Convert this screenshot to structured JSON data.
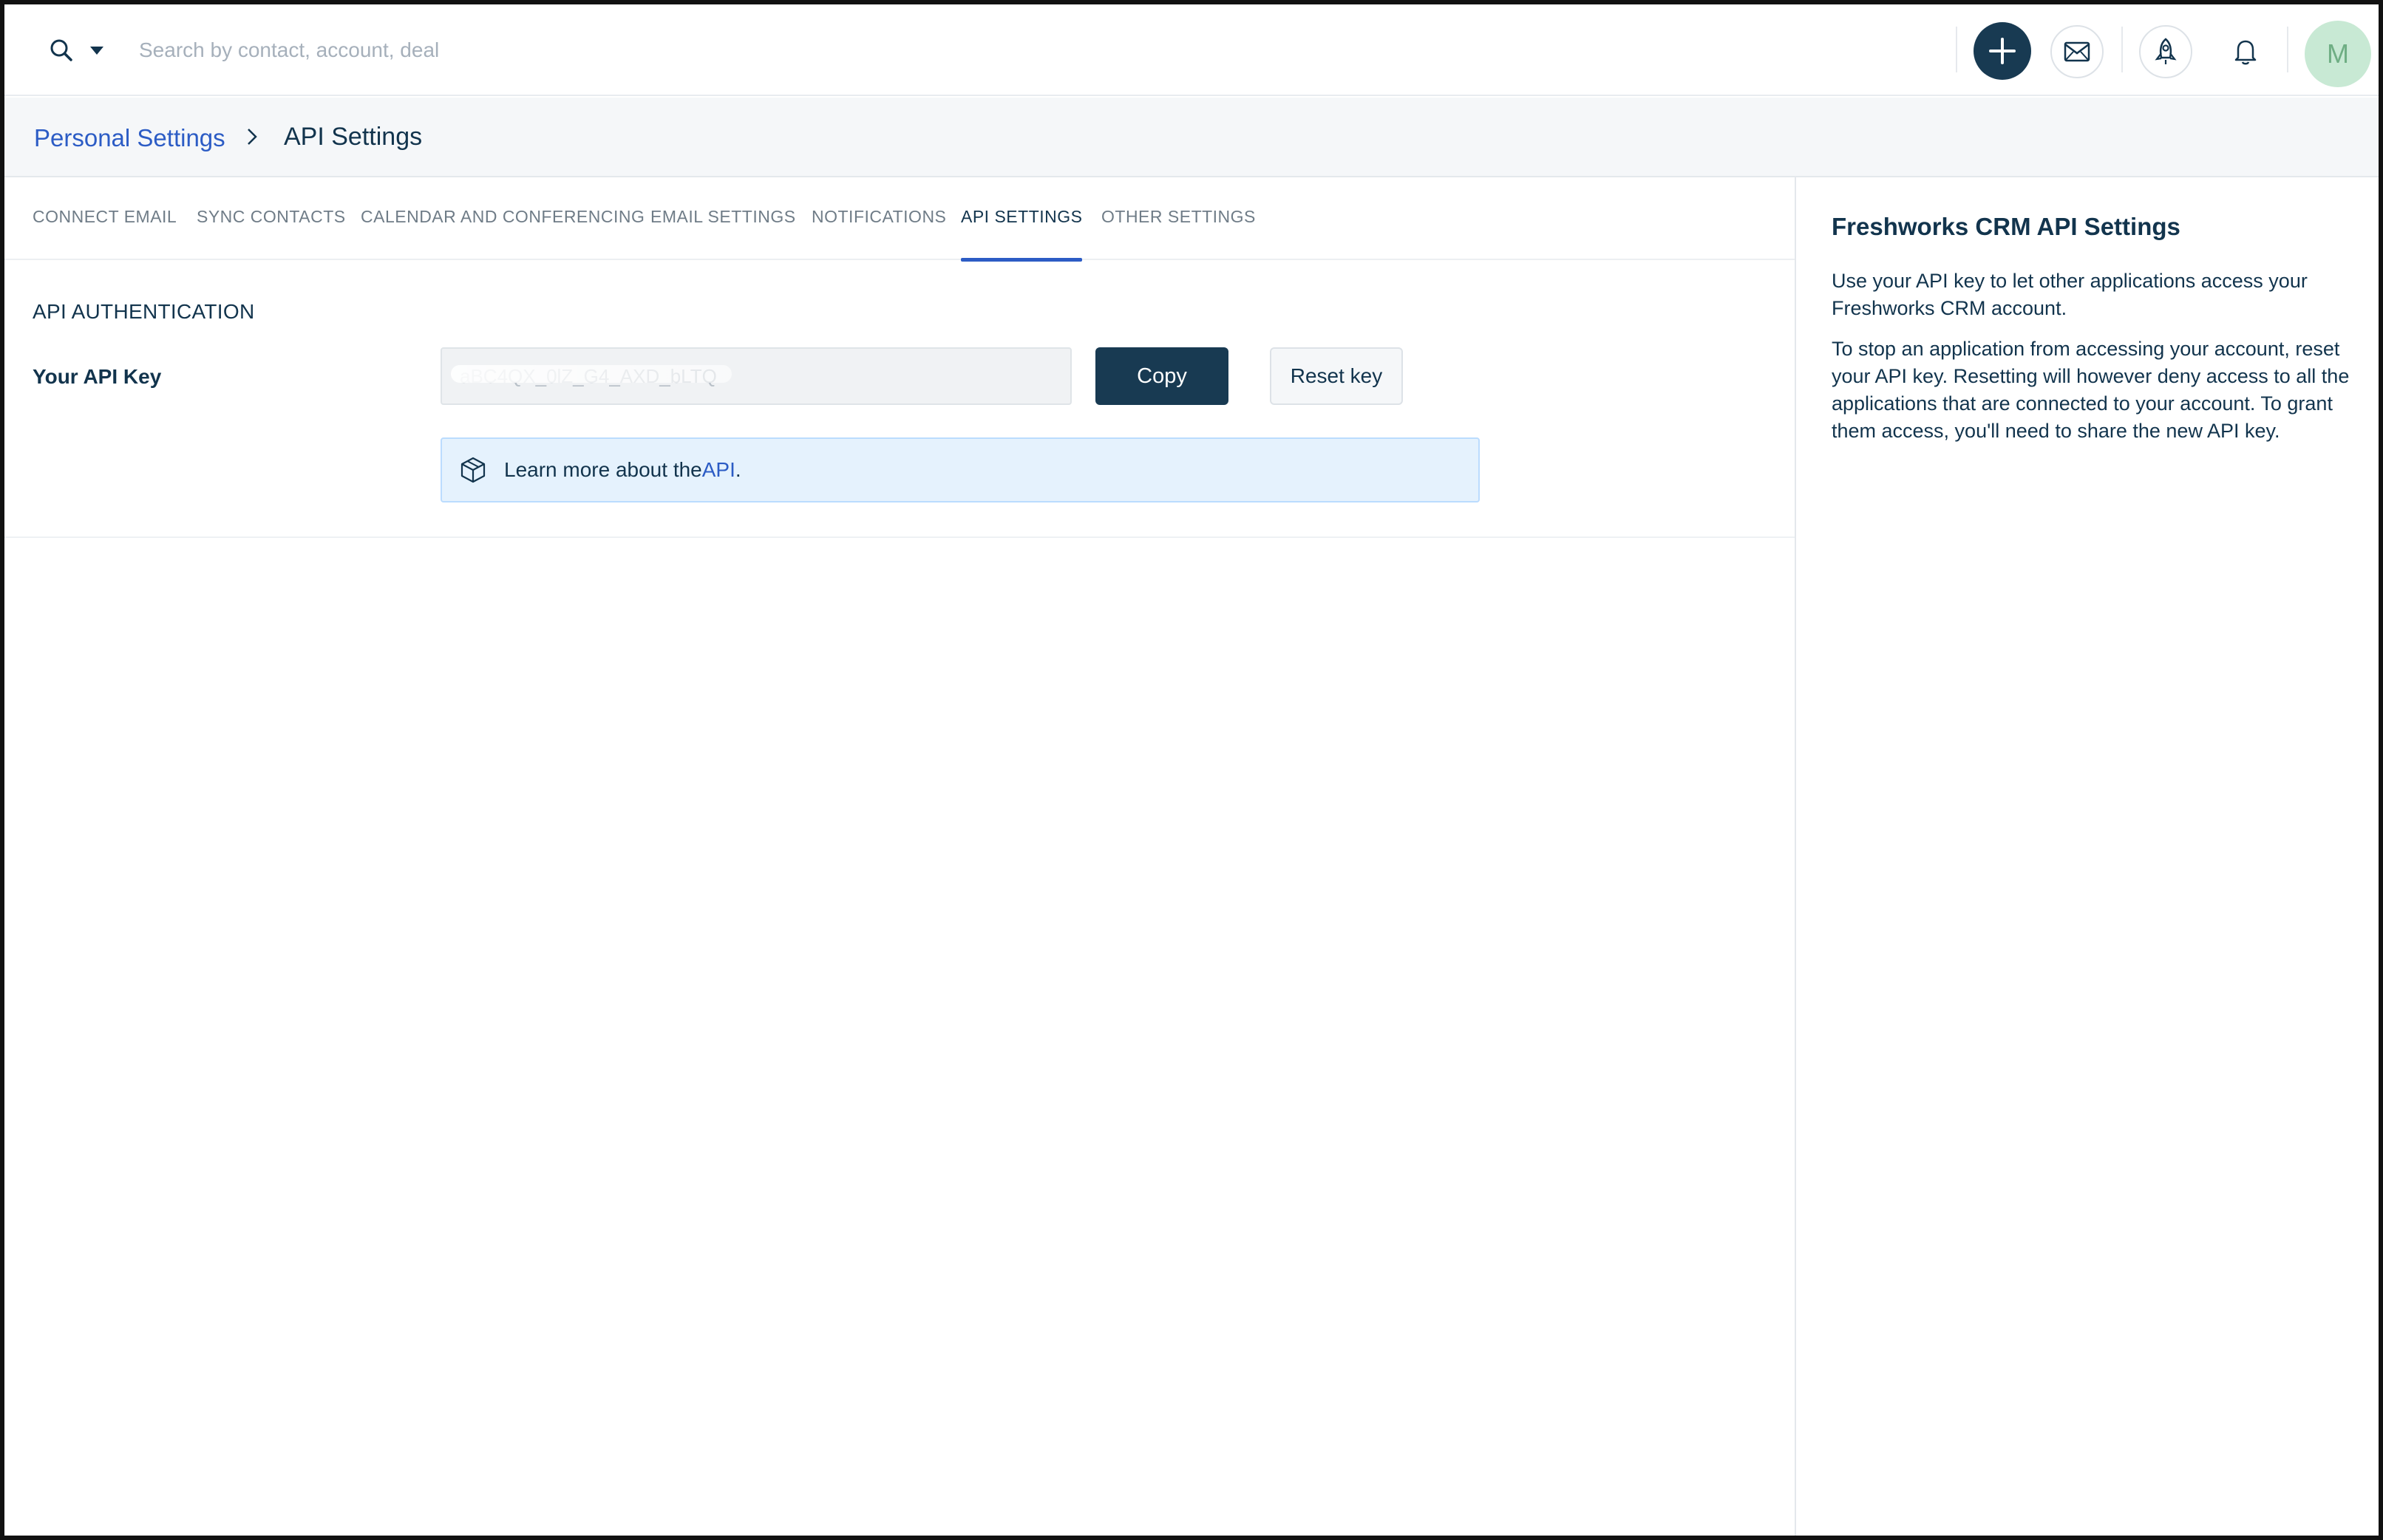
{
  "search": {
    "placeholder": "Search by contact, account, deal"
  },
  "topbar": {
    "avatar_initial": "M"
  },
  "breadcrumb": {
    "parent": "Personal Settings",
    "current": "API Settings"
  },
  "tabs": [
    {
      "label": "CONNECT EMAIL"
    },
    {
      "label": "SYNC CONTACTS"
    },
    {
      "label": "CALENDAR AND CONFERENCING"
    },
    {
      "label": "EMAIL SETTINGS"
    },
    {
      "label": "NOTIFICATIONS"
    },
    {
      "label": "API SETTINGS"
    },
    {
      "label": "OTHER SETTINGS"
    }
  ],
  "active_tab": "API SETTINGS",
  "api": {
    "section_title": "API AUTHENTICATION",
    "key_label": "Your API Key",
    "key_value": "aBC4QX_0lZ_G4_AXD_bLTQ",
    "copy_label": "Copy",
    "reset_label": "Reset key",
    "info_prefix": "Learn more about the ",
    "info_link": "API",
    "info_suffix": "."
  },
  "side": {
    "title": "Freshworks CRM API Settings",
    "p1": "Use your API key to let other applications access your Freshworks CRM account.",
    "p2": "To stop an application from accessing your account, reset your API key. Resetting will however deny access to all the applications that are connected to your account. To grant them access, you'll need to share the new API key."
  },
  "colors": {
    "accent": "#2c5cc5",
    "primary_button": "#183a52",
    "info_bg": "#e5f2fd",
    "avatar_bg": "#c8e9d4"
  }
}
